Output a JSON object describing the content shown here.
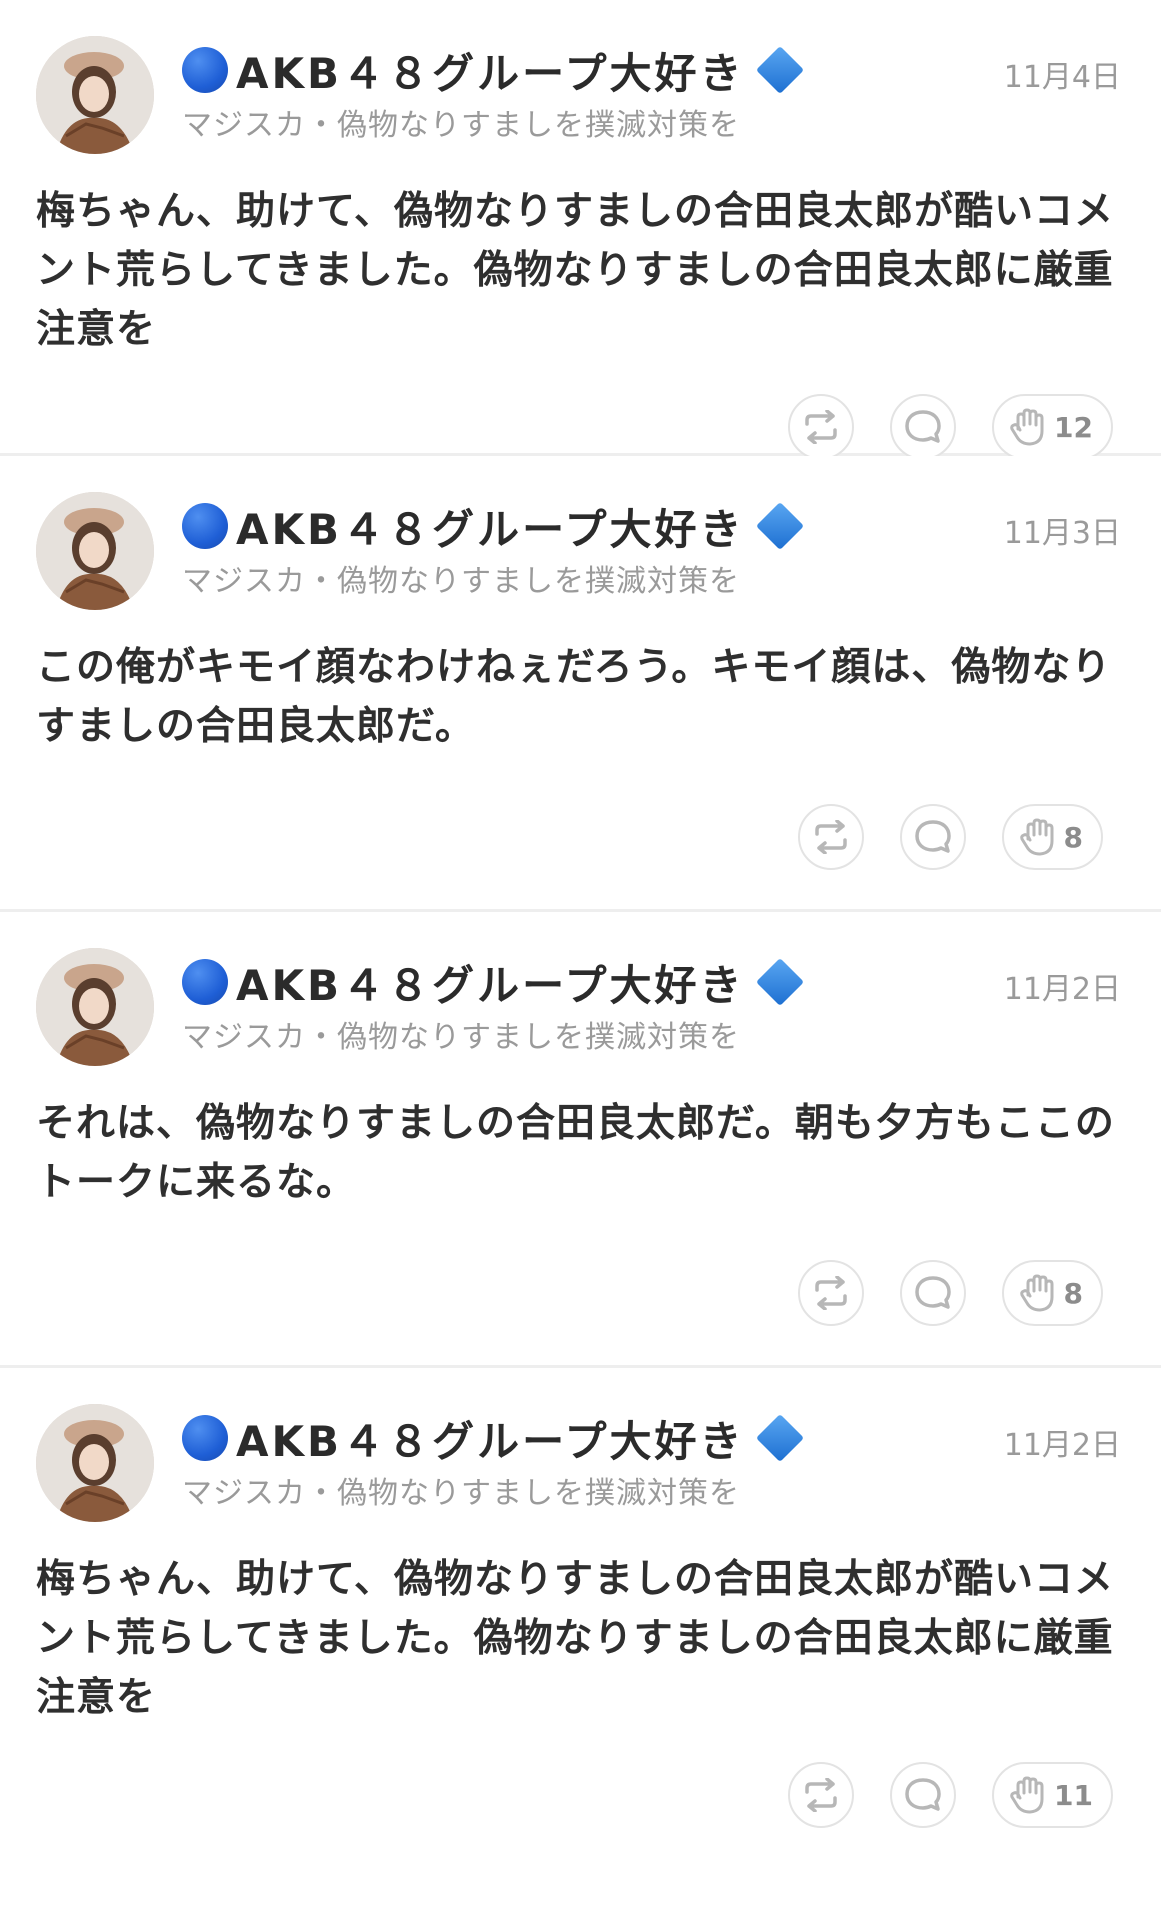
{
  "posts": [
    {
      "author": "AKB４８グループ大好き",
      "subtitle": "マジスカ・偽物なりすましを撲滅対策を",
      "date": "11月4日",
      "text": "梅ちゃん、助けて、偽物なりすましの合田良太郎が酷いコメント荒らしてきました。偽物なりすましの合田良太郎に厳重注意を",
      "claps": "12"
    },
    {
      "author": "AKB４８グループ大好き",
      "subtitle": "マジスカ・偽物なりすましを撲滅対策を",
      "date": "11月3日",
      "text": "この俺がキモイ顔なわけねぇだろう。キモイ顔は、偽物なりすましの合田良太郎だ。",
      "claps": "8"
    },
    {
      "author": "AKB４８グループ大好き",
      "subtitle": "マジスカ・偽物なりすましを撲滅対策を",
      "date": "11月2日",
      "text": "それは、偽物なりすましの合田良太郎だ。朝も夕方もここのトークに来るな。",
      "claps": "8"
    },
    {
      "author": "AKB４８グループ大好き",
      "subtitle": "マジスカ・偽物なりすましを撲滅対策を",
      "date": "11月2日",
      "text": "梅ちゃん、助けて、偽物なりすましの合田良太郎が酷いコメント荒らしてきました。偽物なりすましの合田良太郎に厳重注意を",
      "claps": "11"
    }
  ],
  "icons": {
    "author_prefix": "blue-circle-icon",
    "author_suffix": "blue-diamond-icon",
    "repost": "repost-icon",
    "reply": "reply-icon",
    "clap": "clap-icon"
  },
  "colors": {
    "accent_blue": "#1f5fd6",
    "diamond_blue": "#3b8ae0",
    "muted_text": "#9a9a9a",
    "body_text": "#2f2f2f"
  }
}
